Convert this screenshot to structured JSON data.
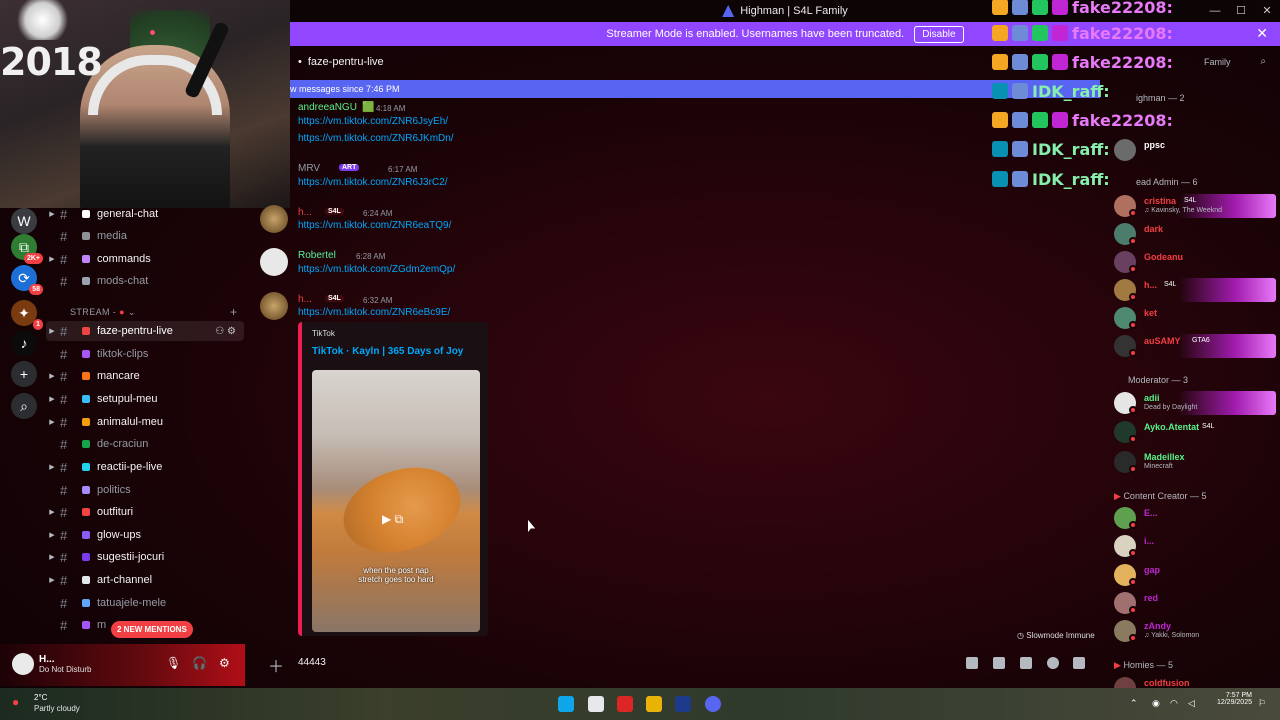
{
  "window": {
    "title": "Highman | S4L Family",
    "controls": [
      "—",
      "☐",
      "✕"
    ]
  },
  "streamer_bar": {
    "text": "Streamer Mode is enabled. Usernames have been truncated.",
    "disable_label": "Disable",
    "close": "✕"
  },
  "webcam": {
    "year_text": "2018"
  },
  "servers": [
    {
      "icon": "W"
    },
    {
      "icon": "⧉",
      "badge": "2K+"
    },
    {
      "icon": "⟳",
      "badge": "58"
    },
    {
      "icon": "✦",
      "badge": "1"
    },
    {
      "icon": "♪"
    },
    {
      "icon": "+"
    },
    {
      "icon": "⌕"
    }
  ],
  "channels": {
    "group1": [
      {
        "name": "general-chat",
        "bright": true,
        "caret": true,
        "emoji_color": "#ffffff"
      },
      {
        "name": "media",
        "bright": false,
        "caret": false,
        "emoji_color": "#8e9297"
      },
      {
        "name": "commands",
        "bright": true,
        "caret": true,
        "emoji_color": "#c084fc"
      },
      {
        "name": "mods-chat",
        "bright": false,
        "caret": false,
        "emoji_color": "#9ca3af"
      }
    ],
    "category": "STREAM -",
    "group2": [
      {
        "name": "faze-pentru-live",
        "bright": true,
        "caret": true,
        "active": true,
        "emoji_color": "#ef4444"
      },
      {
        "name": "tiktok-clips",
        "bright": false,
        "caret": false,
        "emoji_color": "#a855f7"
      },
      {
        "name": "mancare",
        "bright": true,
        "caret": true,
        "emoji_color": "#f97316"
      },
      {
        "name": "setupul-meu",
        "bright": true,
        "caret": true,
        "emoji_color": "#38bdf8"
      },
      {
        "name": "animalul-meu",
        "bright": true,
        "caret": true,
        "emoji_color": "#f59e0b"
      },
      {
        "name": "de-craciun",
        "bright": false,
        "caret": false,
        "emoji_color": "#16a34a"
      },
      {
        "name": "reactii-pe-live",
        "bright": true,
        "caret": true,
        "emoji_color": "#22d3ee"
      },
      {
        "name": "politics",
        "bright": false,
        "caret": false,
        "emoji_color": "#a78bfa"
      },
      {
        "name": "outfituri",
        "bright": true,
        "caret": true,
        "emoji_color": "#ef4444"
      },
      {
        "name": "glow-ups",
        "bright": true,
        "caret": true,
        "emoji_color": "#8b5cf6"
      },
      {
        "name": "sugestii-jocuri",
        "bright": true,
        "caret": true,
        "emoji_color": "#7c3aed"
      },
      {
        "name": "art-channel",
        "bright": true,
        "caret": true,
        "emoji_color": "#e5e7eb"
      },
      {
        "name": "tatuajele-mele",
        "bright": false,
        "caret": false,
        "emoji_color": "#60a5fa"
      },
      {
        "name": "m",
        "bright": false,
        "caret": false,
        "emoji_color": "#a855f7"
      }
    ],
    "new_mentions": "2 NEW MENTIONS"
  },
  "user_panel": {
    "name": "H...",
    "status": "Do Not Disturb"
  },
  "chat": {
    "channel_title": "faze-pentru-live",
    "new_messages_banner": "w messages since 7:46 PM",
    "messages": [
      {
        "author": "andreeaNGU",
        "time": "4:18 AM",
        "color": "#57f287",
        "links": [
          "https://vm.tiktok.com/ZNR6JsyEh/",
          "https://vm.tiktok.com/ZNR6JKmDn/"
        ]
      },
      {
        "author": "MRV",
        "tag": "ART",
        "time": "6:17 AM",
        "color": "#949ba4",
        "links": [
          "https://vm.tiktok.com/ZNR6J3rC2/"
        ]
      },
      {
        "author": "h...",
        "tag": "S4L",
        "time": "6:24 AM",
        "color": "#f23f43",
        "links": [
          "https://vm.tiktok.com/ZNR6eaTQ9/"
        ]
      },
      {
        "author": "Robertel",
        "time": "6:28 AM",
        "color": "#57f2a0",
        "links": [
          "https://vm.tiktok.com/ZGdm2emQp/"
        ]
      },
      {
        "author": "h...",
        "tag": "S4L",
        "time": "6:32 AM",
        "color": "#f23f43",
        "links": [
          "https://vm.tiktok.com/ZNR6eBc9E/"
        ]
      }
    ],
    "embed": {
      "provider": "TikTok",
      "title": "TikTok · Kayln | 365 Days of Joy",
      "caption_line1": "when the post nap",
      "caption_line2": "stretch goes too hard"
    },
    "slowmode": "Slowmode Immune",
    "input_value": "44443"
  },
  "members": {
    "search_placeholder": "Family",
    "groups": [
      {
        "label": "ighman — 2"
      },
      {
        "label": "ead Admin — 6"
      },
      {
        "label": "Moderator — 3"
      },
      {
        "label": "Content Creator — 5"
      },
      {
        "label": "Homies — 5"
      }
    ],
    "list": [
      {
        "name": "ppsc",
        "color": "#ffffff",
        "activity": ""
      },
      {
        "name": "cristina",
        "tag": "S4L",
        "color": "#f23f43",
        "activity": "♫ Kavinsky, The Weeknd"
      },
      {
        "name": "dark",
        "color": "#f23f43",
        "activity": ""
      },
      {
        "name": "Godeanu",
        "color": "#f23f43",
        "activity": ""
      },
      {
        "name": "h...",
        "tag": "S4L",
        "color": "#f23f43",
        "activity": ""
      },
      {
        "name": "ket",
        "color": "#f23f43",
        "activity": ""
      },
      {
        "name": "auSAMY",
        "tag": "GTA6",
        "color": "#f23f43",
        "activity": ""
      },
      {
        "name": "adii",
        "color": "#57f287",
        "activity": "Dead by Daylight"
      },
      {
        "name": "Ayko.Atentat",
        "tag": "S4L",
        "color": "#57f287",
        "activity": ""
      },
      {
        "name": "Madeillex",
        "color": "#57f287",
        "activity": "Minecraft"
      },
      {
        "name": "E...",
        "color": "#c026d3",
        "activity": ""
      },
      {
        "name": "i...",
        "color": "#c026d3",
        "activity": ""
      },
      {
        "name": "gap",
        "color": "#c026d3",
        "activity": ""
      },
      {
        "name": "red",
        "color": "#c026d3",
        "activity": ""
      },
      {
        "name": "zAndy",
        "color": "#c026d3",
        "activity": "♫ Yakki, Solomon"
      },
      {
        "name": "coldfusion",
        "color": "#f23f43",
        "activity": ""
      }
    ]
  },
  "stream_overlay": [
    {
      "name": "fake22208:",
      "color": "#e879f9"
    },
    {
      "name": "fake22208:",
      "color": "#e879f9"
    },
    {
      "name": "fake22208:",
      "color": "#e879f9"
    },
    {
      "name": "IDK_raff:",
      "color": "#86efac"
    },
    {
      "name": "fake22208:",
      "color": "#e879f9"
    },
    {
      "name": "IDK_raff:",
      "color": "#86efac"
    },
    {
      "name": "IDK_raff:",
      "color": "#86efac"
    }
  ],
  "taskbar": {
    "temp": "2°C",
    "weather": "Partly cloudy",
    "time": "7:57 PM",
    "date": "12/29/2025"
  }
}
